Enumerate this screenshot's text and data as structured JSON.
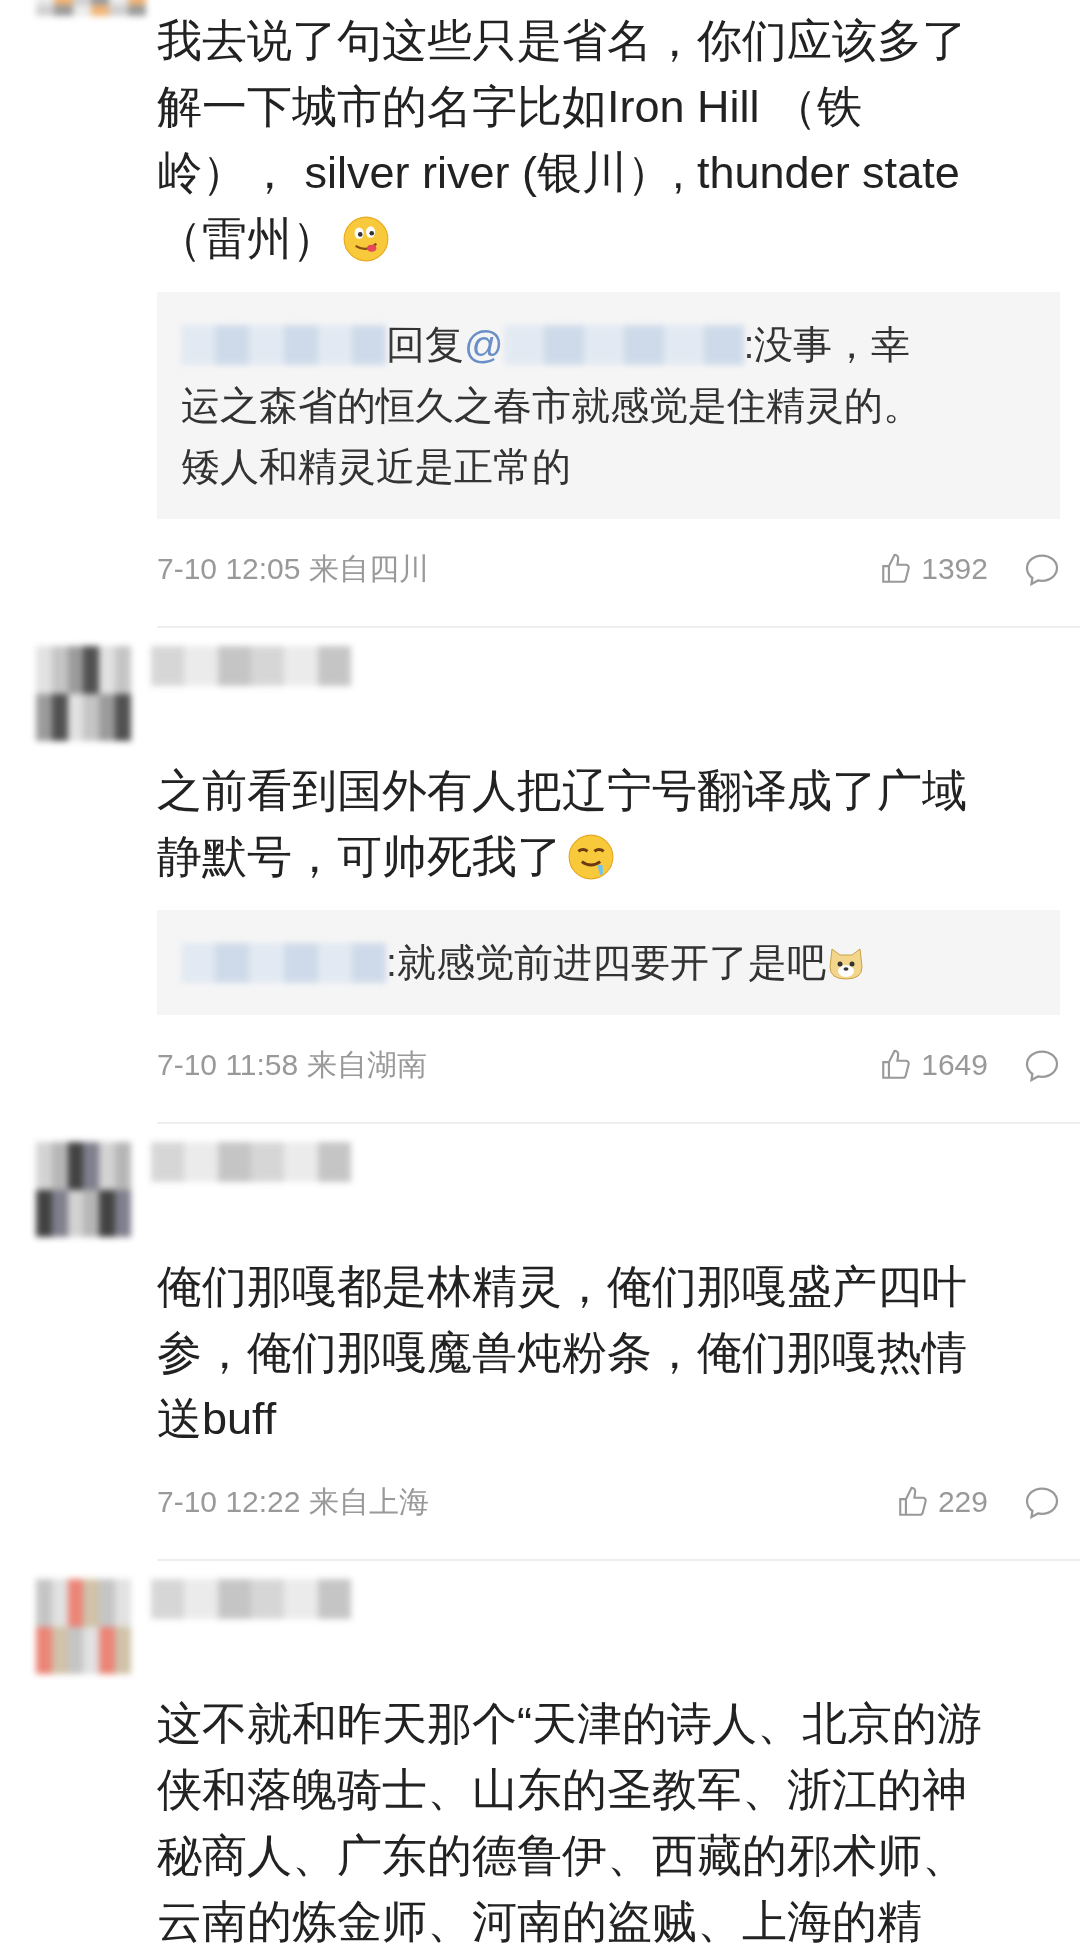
{
  "comments": [
    {
      "kind": "cut",
      "lines": [
        "我去说了句这些只是省名，你们应该多了",
        "解一下城市的名字比如Iron Hill （铁",
        "岭）， silver river (银川）, thunder state",
        "（雷州）"
      ],
      "emoji": {
        "kind": "tongue"
      },
      "reply": {
        "lines": [
          [
            {
              "kind": "blur"
            },
            {
              "kind": "text",
              "text": "回复"
            },
            {
              "kind": "mention",
              "text": "@"
            },
            {
              "kind": "blur"
            },
            {
              "kind": "text",
              "text": ":没事，幸"
            }
          ],
          [
            {
              "kind": "text",
              "text": "运之森省的恒久之春市就感觉是住精灵的。"
            }
          ],
          [
            {
              "kind": "text",
              "text": "矮人和精灵近是正常的"
            }
          ]
        ]
      },
      "meta": {
        "time": "7-10 12:05 来自四川",
        "likes": "1392"
      }
    },
    {
      "kind": "full",
      "lines": [
        "之前看到国外有人把辽宁号翻译成了广域",
        "静默号，可帅死我了"
      ],
      "emoji": {
        "kind": "drool"
      },
      "reply": {
        "lines": [
          [
            {
              "kind": "blur"
            },
            {
              "kind": "text",
              "text": ":就感觉前进四要开了是吧"
            },
            {
              "kind": "dog"
            }
          ]
        ]
      },
      "meta": {
        "time": "7-10 11:58 来自湖南",
        "likes": "1649"
      }
    },
    {
      "kind": "full",
      "lines": [
        "俺们那嘎都是林精灵，俺们那嘎盛产四叶",
        "参，俺们那嘎魔兽炖粉条，俺们那嘎热情",
        "送buff"
      ],
      "meta": {
        "time": "7-10 12:22 来自上海",
        "likes": "229"
      }
    },
    {
      "kind": "full",
      "lines": [
        "这不就和昨天那个“天津的诗人、北京的游",
        "侠和落魄骑士、山东的圣教军、浙江的神",
        "秘商人、广东的德鲁伊、西藏的邪术师、",
        "云南的炼金师、河南的盗贼、上海的精"
      ]
    }
  ]
}
